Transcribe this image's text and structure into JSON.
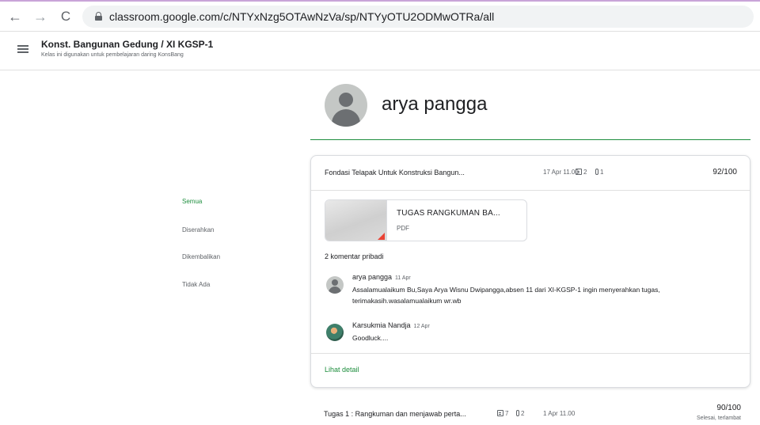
{
  "browser": {
    "url": "classroom.google.com/c/NTYxNzg5OTAwNzVa/sp/NTYyOTU2ODMwOTRa/all",
    "back_glyph": "←",
    "forward_glyph": "→",
    "reload_glyph": "C"
  },
  "class": {
    "title": "Konst. Bangunan Gedung / XI KGSP-1",
    "subtitle": "Kelas ini digunakan untuk pembelajaran daring KonsBang"
  },
  "student": {
    "name": "arya pangga"
  },
  "filters": [
    {
      "label": "Semua",
      "active": true
    },
    {
      "label": "Diserahkan",
      "active": false
    },
    {
      "label": "Dikembalikan",
      "active": false
    },
    {
      "label": "Tidak Ada",
      "active": false
    }
  ],
  "assignment": {
    "title": "Fondasi Telapak Untuk Konstruksi Bangun...",
    "doc_count": "2",
    "attachment_count": "1",
    "due": "17 Apr 11.00",
    "score": "92/100",
    "attachment": {
      "title": "TUGAS RANGKUMAN BA...",
      "type": "PDF"
    },
    "comments_label": "2 komentar pribadi",
    "comments": [
      {
        "author": "arya pangga",
        "date": "11 Apr",
        "text": "Assalamualaikum Bu,Saya Arya Wisnu Dwipangga,absen 11 dari XI-KGSP-1 ingin menyerahkan tugas, terimakasih.wasalamualaikum wr.wb"
      },
      {
        "author": "Karsukmia Nandja",
        "date": "12 Apr",
        "text": "Goodluck...."
      }
    ],
    "view_detail": "Lihat detail"
  },
  "assignment2": {
    "title": "Tugas 1 : Rangkuman dan menjawab perta...",
    "doc_count": "7",
    "attachment_count": "2",
    "due": "1 Apr 11.00",
    "score": "90/100",
    "status": "Selesai, terlambat"
  },
  "colors": {
    "accent_green": "#1e8e3e",
    "pdf_red": "#ea4335"
  }
}
